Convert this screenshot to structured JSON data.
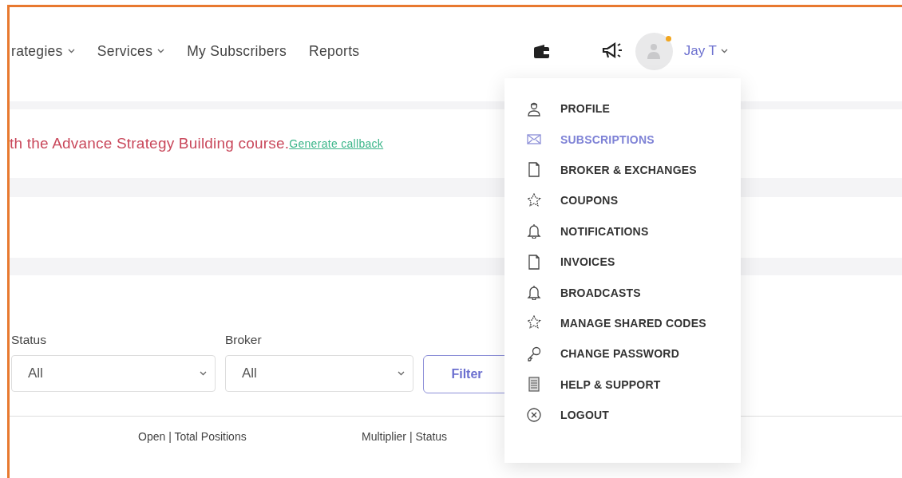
{
  "nav": {
    "items": [
      {
        "label": "rategies",
        "kind": "dropdown"
      },
      {
        "label": "Services",
        "kind": "dropdown"
      },
      {
        "label": "My Subscribers",
        "kind": "link"
      },
      {
        "label": "Reports",
        "kind": "link"
      }
    ],
    "user": {
      "name": "Jay T"
    }
  },
  "alert": {
    "message": "th the Advance Strategy Building course.",
    "link": "Generate callback"
  },
  "filters": [
    {
      "label": "Status",
      "value": "All"
    },
    {
      "label": "Broker",
      "value": "All"
    }
  ],
  "filter_button": "Filter",
  "table": {
    "columns": [
      "Open | Total Positions",
      "Multiplier | Status"
    ]
  },
  "user_menu": {
    "items": [
      {
        "label": "PROFILE",
        "kind": "person",
        "selected": false
      },
      {
        "label": "SUBSCRIPTIONS",
        "kind": "envelope",
        "selected": true
      },
      {
        "label": "BROKER & EXCHANGES",
        "kind": "document",
        "selected": false
      },
      {
        "label": "COUPONS",
        "kind": "star",
        "selected": false
      },
      {
        "label": "NOTIFICATIONS",
        "kind": "bell",
        "selected": false
      },
      {
        "label": "INVOICES",
        "kind": "document",
        "selected": false
      },
      {
        "label": "BROADCASTS",
        "kind": "bell",
        "selected": false
      },
      {
        "label": "MANAGE SHARED CODES",
        "kind": "star",
        "selected": false
      },
      {
        "label": "CHANGE PASSWORD",
        "kind": "key",
        "selected": false
      },
      {
        "label": "HELP & SUPPORT",
        "kind": "list",
        "selected": false
      },
      {
        "label": "LOGOUT",
        "kind": "circle-x",
        "selected": false
      }
    ]
  }
}
